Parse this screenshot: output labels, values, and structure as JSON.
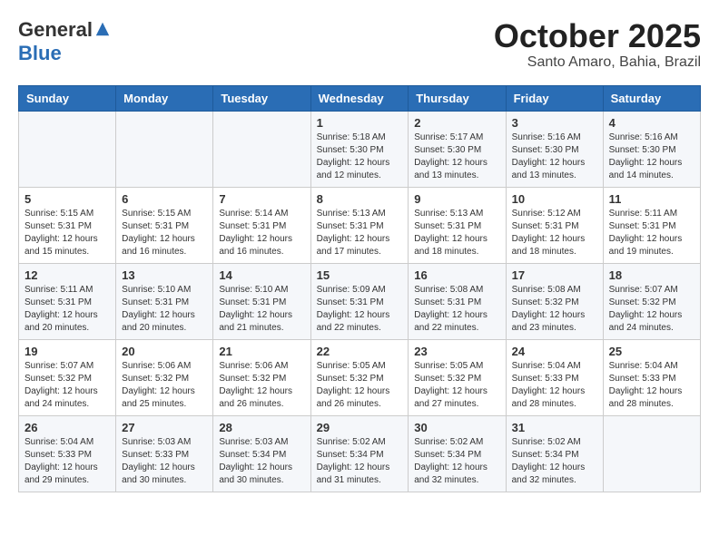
{
  "header": {
    "logo": {
      "general": "General",
      "blue": "Blue"
    },
    "title": "October 2025",
    "location": "Santo Amaro, Bahia, Brazil"
  },
  "weekdays": [
    "Sunday",
    "Monday",
    "Tuesday",
    "Wednesday",
    "Thursday",
    "Friday",
    "Saturday"
  ],
  "weeks": [
    [
      {
        "day": "",
        "info": ""
      },
      {
        "day": "",
        "info": ""
      },
      {
        "day": "",
        "info": ""
      },
      {
        "day": "1",
        "info": "Sunrise: 5:18 AM\nSunset: 5:30 PM\nDaylight: 12 hours\nand 12 minutes."
      },
      {
        "day": "2",
        "info": "Sunrise: 5:17 AM\nSunset: 5:30 PM\nDaylight: 12 hours\nand 13 minutes."
      },
      {
        "day": "3",
        "info": "Sunrise: 5:16 AM\nSunset: 5:30 PM\nDaylight: 12 hours\nand 13 minutes."
      },
      {
        "day": "4",
        "info": "Sunrise: 5:16 AM\nSunset: 5:30 PM\nDaylight: 12 hours\nand 14 minutes."
      }
    ],
    [
      {
        "day": "5",
        "info": "Sunrise: 5:15 AM\nSunset: 5:31 PM\nDaylight: 12 hours\nand 15 minutes."
      },
      {
        "day": "6",
        "info": "Sunrise: 5:15 AM\nSunset: 5:31 PM\nDaylight: 12 hours\nand 16 minutes."
      },
      {
        "day": "7",
        "info": "Sunrise: 5:14 AM\nSunset: 5:31 PM\nDaylight: 12 hours\nand 16 minutes."
      },
      {
        "day": "8",
        "info": "Sunrise: 5:13 AM\nSunset: 5:31 PM\nDaylight: 12 hours\nand 17 minutes."
      },
      {
        "day": "9",
        "info": "Sunrise: 5:13 AM\nSunset: 5:31 PM\nDaylight: 12 hours\nand 18 minutes."
      },
      {
        "day": "10",
        "info": "Sunrise: 5:12 AM\nSunset: 5:31 PM\nDaylight: 12 hours\nand 18 minutes."
      },
      {
        "day": "11",
        "info": "Sunrise: 5:11 AM\nSunset: 5:31 PM\nDaylight: 12 hours\nand 19 minutes."
      }
    ],
    [
      {
        "day": "12",
        "info": "Sunrise: 5:11 AM\nSunset: 5:31 PM\nDaylight: 12 hours\nand 20 minutes."
      },
      {
        "day": "13",
        "info": "Sunrise: 5:10 AM\nSunset: 5:31 PM\nDaylight: 12 hours\nand 20 minutes."
      },
      {
        "day": "14",
        "info": "Sunrise: 5:10 AM\nSunset: 5:31 PM\nDaylight: 12 hours\nand 21 minutes."
      },
      {
        "day": "15",
        "info": "Sunrise: 5:09 AM\nSunset: 5:31 PM\nDaylight: 12 hours\nand 22 minutes."
      },
      {
        "day": "16",
        "info": "Sunrise: 5:08 AM\nSunset: 5:31 PM\nDaylight: 12 hours\nand 22 minutes."
      },
      {
        "day": "17",
        "info": "Sunrise: 5:08 AM\nSunset: 5:32 PM\nDaylight: 12 hours\nand 23 minutes."
      },
      {
        "day": "18",
        "info": "Sunrise: 5:07 AM\nSunset: 5:32 PM\nDaylight: 12 hours\nand 24 minutes."
      }
    ],
    [
      {
        "day": "19",
        "info": "Sunrise: 5:07 AM\nSunset: 5:32 PM\nDaylight: 12 hours\nand 24 minutes."
      },
      {
        "day": "20",
        "info": "Sunrise: 5:06 AM\nSunset: 5:32 PM\nDaylight: 12 hours\nand 25 minutes."
      },
      {
        "day": "21",
        "info": "Sunrise: 5:06 AM\nSunset: 5:32 PM\nDaylight: 12 hours\nand 26 minutes."
      },
      {
        "day": "22",
        "info": "Sunrise: 5:05 AM\nSunset: 5:32 PM\nDaylight: 12 hours\nand 26 minutes."
      },
      {
        "day": "23",
        "info": "Sunrise: 5:05 AM\nSunset: 5:32 PM\nDaylight: 12 hours\nand 27 minutes."
      },
      {
        "day": "24",
        "info": "Sunrise: 5:04 AM\nSunset: 5:33 PM\nDaylight: 12 hours\nand 28 minutes."
      },
      {
        "day": "25",
        "info": "Sunrise: 5:04 AM\nSunset: 5:33 PM\nDaylight: 12 hours\nand 28 minutes."
      }
    ],
    [
      {
        "day": "26",
        "info": "Sunrise: 5:04 AM\nSunset: 5:33 PM\nDaylight: 12 hours\nand 29 minutes."
      },
      {
        "day": "27",
        "info": "Sunrise: 5:03 AM\nSunset: 5:33 PM\nDaylight: 12 hours\nand 30 minutes."
      },
      {
        "day": "28",
        "info": "Sunrise: 5:03 AM\nSunset: 5:34 PM\nDaylight: 12 hours\nand 30 minutes."
      },
      {
        "day": "29",
        "info": "Sunrise: 5:02 AM\nSunset: 5:34 PM\nDaylight: 12 hours\nand 31 minutes."
      },
      {
        "day": "30",
        "info": "Sunrise: 5:02 AM\nSunset: 5:34 PM\nDaylight: 12 hours\nand 32 minutes."
      },
      {
        "day": "31",
        "info": "Sunrise: 5:02 AM\nSunset: 5:34 PM\nDaylight: 12 hours\nand 32 minutes."
      },
      {
        "day": "",
        "info": ""
      }
    ]
  ]
}
